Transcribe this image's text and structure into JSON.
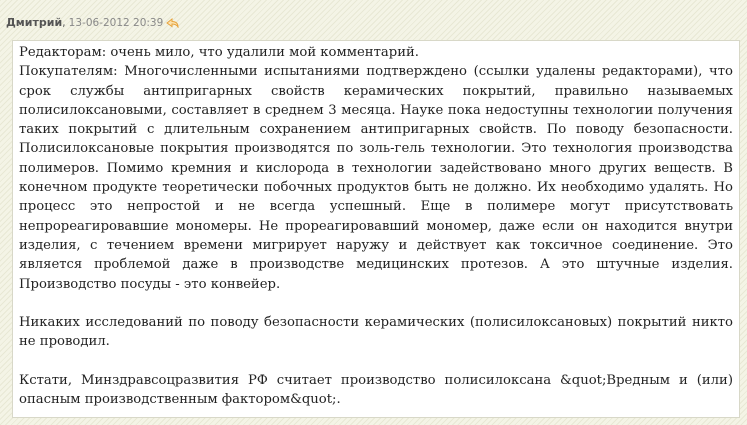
{
  "comment": {
    "author": "Дмитрий",
    "separator": ",",
    "date": "13-06-2012 20:39",
    "reply_icon": "reply-arrow-icon",
    "paragraphs": [
      "Редакторам: очень мило, что удалили мой комментарий.",
      "Покупателям: Многочисленными испытаниями подтверждено (ссылки удалены редакторами), что срок службы антипригарных свойств керамических покрытий, правильно называемых полисилоксановыми, составляет в среднем 3 месяца. Науке пока недоступны технологии получения таких покрытий с длительным сохранением антипригарных свойств. По поводу безопасности. Полисилоксановые покрытия производятся по золь-гель технологии. Это технология производства полимеров. Помимо кремния и кислорода в технологии задействовано много других веществ. В конечном продукте теоретически побочных продуктов быть не должно. Их необходимо удалять. Но процесс это непростой и не всегда успешный. Еще в полимере могут присутствовать непрореагировавшие мономеры. Не прореагировавший мономер, даже если он находится внутри изделия, с течением времени мигрирует наружу и действует как токсичное соединение. Это является проблемой даже в производстве медицинских протезов. А это штучные изделия. Производство посуды - это конвейер.",
      "",
      "Никаких исследований по поводу безопасности керамических (полисилоксановых) покрытий никто не проводил.",
      "",
      "Кстати, Минздравсоцразвития РФ считает производство полисилоксана &quot;Вредным и (или) опасным производственным фактором&quot;."
    ]
  }
}
